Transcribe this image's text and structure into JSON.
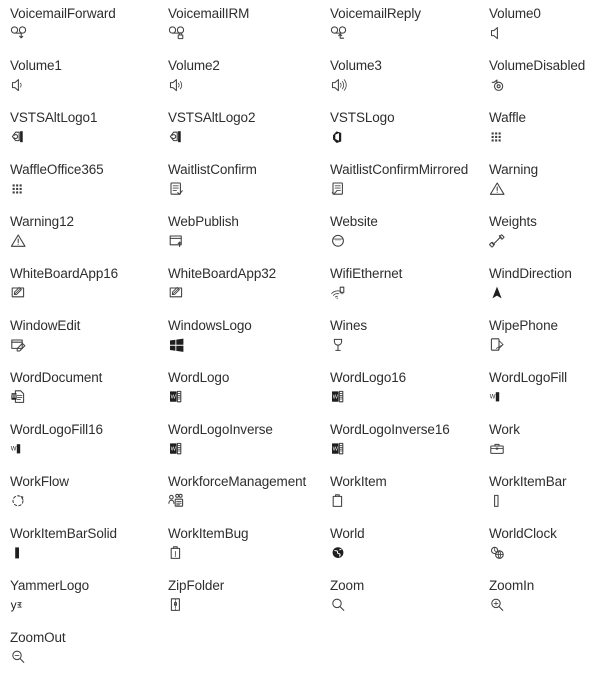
{
  "gallery": {
    "columns": 4,
    "text_color": "#2e2e2e",
    "glyph_color": "#3f3f3f",
    "background": "#ffffff",
    "rows": [
      [
        {
          "label": "VoicemailForward",
          "icon": "voicemail-forward-icon"
        },
        {
          "label": "VoicemailIRM",
          "icon": "voicemail-irm-icon"
        },
        {
          "label": "VoicemailReply",
          "icon": "voicemail-reply-icon"
        },
        {
          "label": "Volume0",
          "icon": "volume-0-icon"
        }
      ],
      [
        {
          "label": "Volume1",
          "icon": "volume-1-icon"
        },
        {
          "label": "Volume2",
          "icon": "volume-2-icon"
        },
        {
          "label": "Volume3",
          "icon": "volume-3-icon"
        },
        {
          "label": "VolumeDisabled",
          "icon": "volume-disabled-icon"
        }
      ],
      [
        {
          "label": "VSTSAltLogo1",
          "icon": "vsts-alt-logo-1-icon"
        },
        {
          "label": "VSTSAltLogo2",
          "icon": "vsts-alt-logo-2-icon"
        },
        {
          "label": "VSTSLogo",
          "icon": "vsts-logo-icon"
        },
        {
          "label": "Waffle",
          "icon": "waffle-icon"
        }
      ],
      [
        {
          "label": "WaffleOffice365",
          "icon": "waffle-office365-icon"
        },
        {
          "label": "WaitlistConfirm",
          "icon": "waitlist-confirm-icon"
        },
        {
          "label": "WaitlistConfirmMirrored",
          "icon": "waitlist-confirm-mirrored-icon"
        },
        {
          "label": "Warning",
          "icon": "warning-icon"
        }
      ],
      [
        {
          "label": "Warning12",
          "icon": "warning-12-icon"
        },
        {
          "label": "WebPublish",
          "icon": "web-publish-icon"
        },
        {
          "label": "Website",
          "icon": "website-icon"
        },
        {
          "label": "Weights",
          "icon": "weights-icon"
        }
      ],
      [
        {
          "label": "WhiteBoardApp16",
          "icon": "whiteboard-app-16-icon"
        },
        {
          "label": "WhiteBoardApp32",
          "icon": "whiteboard-app-32-icon"
        },
        {
          "label": "WifiEthernet",
          "icon": "wifi-ethernet-icon"
        },
        {
          "label": "WindDirection",
          "icon": "wind-direction-icon"
        }
      ],
      [
        {
          "label": "WindowEdit",
          "icon": "window-edit-icon"
        },
        {
          "label": "WindowsLogo",
          "icon": "windows-logo-icon"
        },
        {
          "label": "Wines",
          "icon": "wines-icon"
        },
        {
          "label": "WipePhone",
          "icon": "wipe-phone-icon"
        }
      ],
      [
        {
          "label": "WordDocument",
          "icon": "word-document-icon"
        },
        {
          "label": "WordLogo",
          "icon": "word-logo-icon"
        },
        {
          "label": "WordLogo16",
          "icon": "word-logo-16-icon"
        },
        {
          "label": "WordLogoFill",
          "icon": "word-logo-fill-icon"
        }
      ],
      [
        {
          "label": "WordLogoFill16",
          "icon": "word-logo-fill-16-icon"
        },
        {
          "label": "WordLogoInverse",
          "icon": "word-logo-inverse-icon"
        },
        {
          "label": "WordLogoInverse16",
          "icon": "word-logo-inverse-16-icon"
        },
        {
          "label": "Work",
          "icon": "work-icon"
        }
      ],
      [
        {
          "label": "WorkFlow",
          "icon": "workflow-icon"
        },
        {
          "label": "WorkforceManagement",
          "icon": "workforce-management-icon"
        },
        {
          "label": "WorkItem",
          "icon": "work-item-icon"
        },
        {
          "label": "WorkItemBar",
          "icon": "work-item-bar-icon"
        }
      ],
      [
        {
          "label": "WorkItemBarSolid",
          "icon": "work-item-bar-solid-icon"
        },
        {
          "label": "WorkItemBug",
          "icon": "work-item-bug-icon"
        },
        {
          "label": "World",
          "icon": "world-icon"
        },
        {
          "label": "WorldClock",
          "icon": "world-clock-icon"
        }
      ],
      [
        {
          "label": "YammerLogo",
          "icon": "yammer-logo-icon"
        },
        {
          "label": "ZipFolder",
          "icon": "zip-folder-icon"
        },
        {
          "label": "Zoom",
          "icon": "zoom-icon"
        },
        {
          "label": "ZoomIn",
          "icon": "zoom-in-icon"
        }
      ],
      [
        {
          "label": "ZoomOut",
          "icon": "zoom-out-icon"
        }
      ]
    ]
  }
}
